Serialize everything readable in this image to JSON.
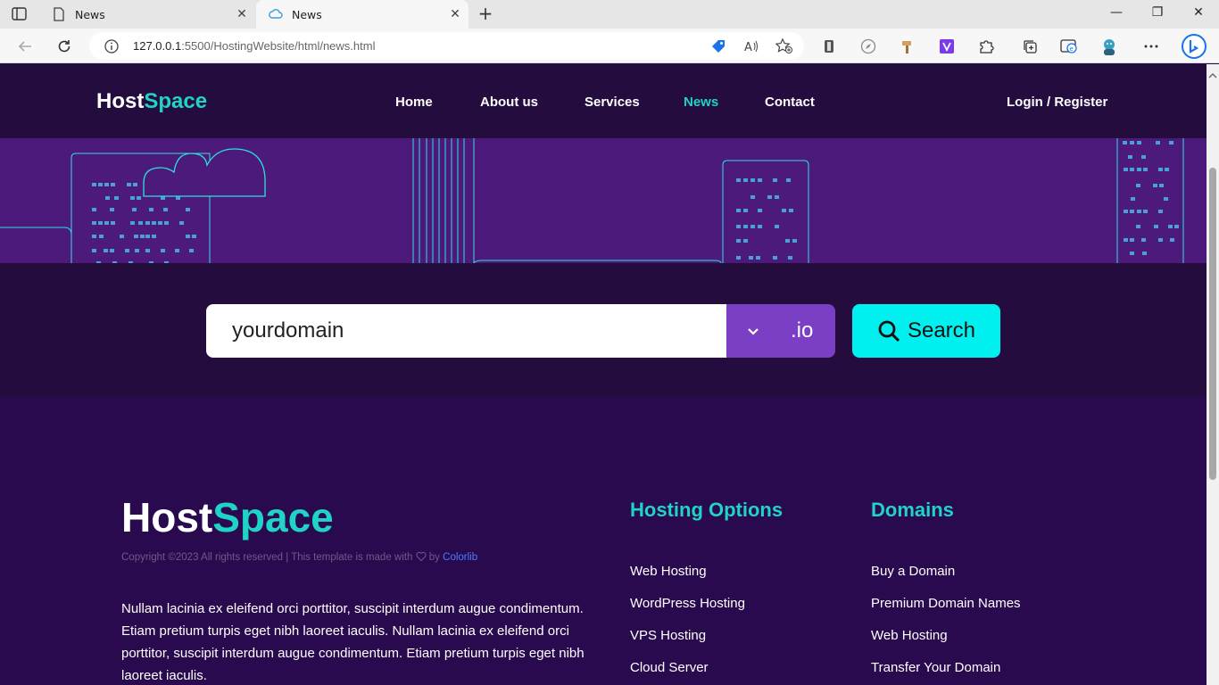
{
  "browser": {
    "tabs": [
      {
        "title": "News",
        "active": false
      },
      {
        "title": "News",
        "active": true
      }
    ],
    "url_host": "127.0.0.1",
    "url_rest": ":5500/HostingWebsite/html/news.html"
  },
  "header": {
    "logo_main": "Host",
    "logo_accent": "Space",
    "nav": [
      "Home",
      "About us",
      "Services",
      "News",
      "Contact"
    ],
    "active_nav": "News",
    "login": "Login / Register"
  },
  "search": {
    "value": "yourdomain",
    "tld": ".io",
    "button": "Search"
  },
  "footer": {
    "logo_main": "Host",
    "logo_accent": "Space",
    "copyright_prefix": "Copyright ©2023 All rights reserved | This template is made with",
    "copyright_by": "by",
    "copyright_link": "Colorlib",
    "text": "Nullam lacinia ex eleifend orci porttitor, suscipit interdum augue condimentum. Etiam pretium turpis eget nibh laoreet iaculis. Nullam lacinia ex eleifend orci porttitor, suscipit interdum augue condimentum. Etiam pretium turpis eget nibh laoreet iaculis.",
    "hosting": {
      "heading": "Hosting Options",
      "links": [
        "Web Hosting",
        "WordPress Hosting",
        "VPS Hosting",
        "Cloud Server"
      ]
    },
    "domains": {
      "heading": "Domains",
      "links": [
        "Buy a Domain",
        "Premium Domain Names",
        "Web Hosting",
        "Transfer Your Domain"
      ]
    }
  },
  "colors": {
    "accent": "#1fd3c6",
    "header_bg": "#240d3e",
    "hero_bg": "#4b1a7a",
    "footer_bg": "#2a0a4e",
    "search_button": "#00f0f0",
    "tld_bg": "#7b3fc6"
  }
}
